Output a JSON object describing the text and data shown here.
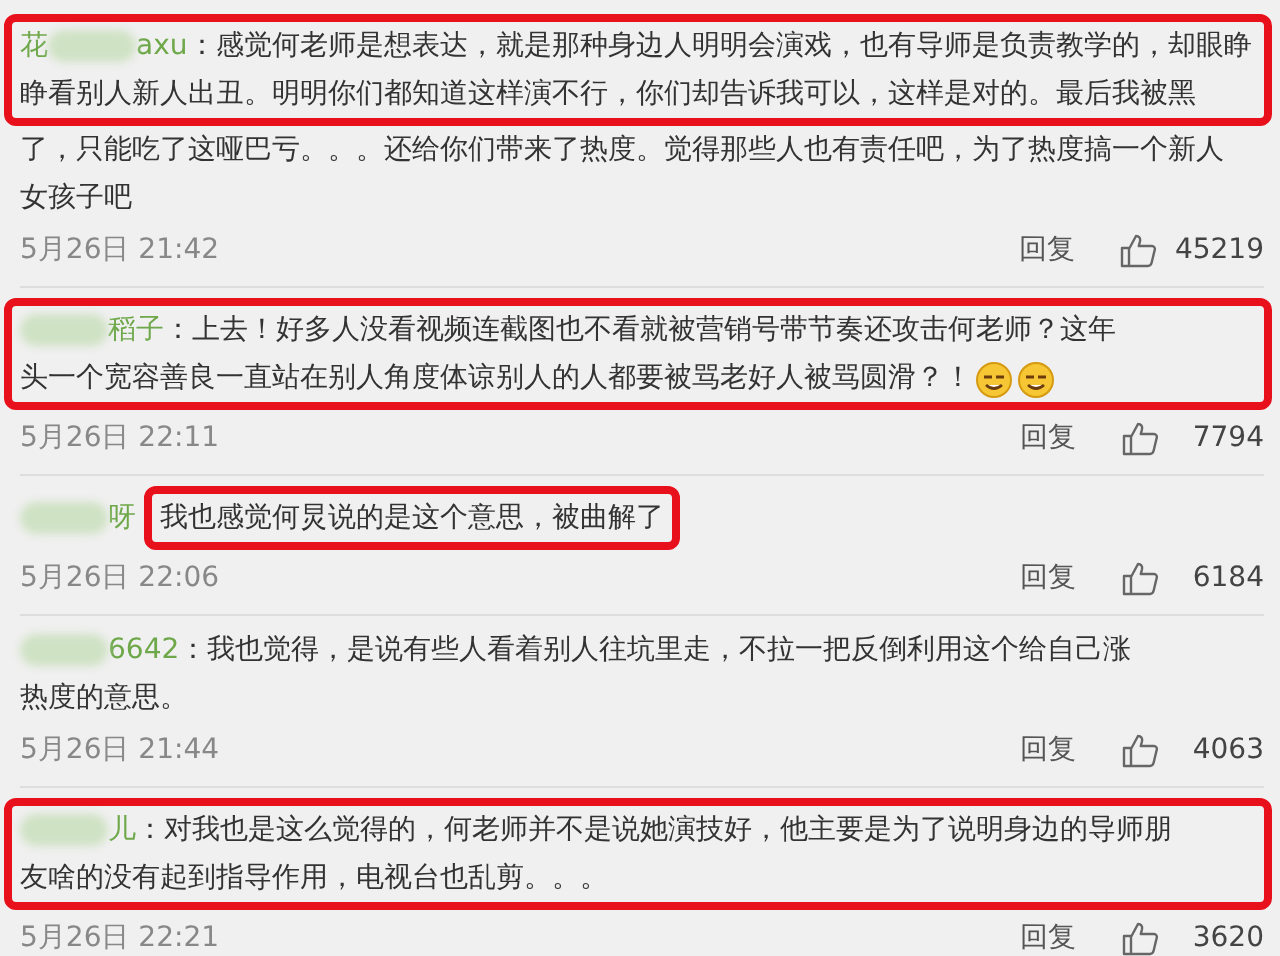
{
  "comments": [
    {
      "username": "axu",
      "username_prefix": "花",
      "username_highlighted": true,
      "lines": [
        {
          "text": "：感觉何老师是想表达，就是那种身边人明明会演戏，也有导师是负责教学的，却眼睁",
          "highlighted": true
        },
        {
          "text": "睁看别人新人出丑。明明你们都知道这样演不行，你们却告诉我可以，这样是对的。最后我被黑",
          "highlighted": true
        },
        {
          "text": "了，只能吃了这哑巴亏。。。还给你们带来了热度。觉得那些人也有责任吧，为了热度搞一个新人",
          "highlighted": false
        },
        {
          "text": "女孩子吧",
          "highlighted": false
        }
      ],
      "time": "5月26日 21:42",
      "reply": "回复",
      "likes": "45219"
    },
    {
      "username": "稻子",
      "username_highlighted": true,
      "lines": [
        {
          "text": "：上去！好多人没看视频连截图也不看就被营销号带节奏还攻击何老师？这年",
          "highlighted": true
        },
        {
          "text": "头一个宽容善良一直站在别人角度体谅别人的人都要被骂老好人被骂圆滑？！",
          "highlighted": true
        }
      ],
      "emojis": [
        {
          "kind": "smiley"
        },
        {
          "kind": "smiley"
        }
      ],
      "time": "5月26日 22:11",
      "reply": "回复",
      "likes": "7794"
    },
    {
      "username": "呀",
      "username_highlighted": false,
      "lines": [
        {
          "text": "我也感觉何炅说的是这个意思，被曲解了",
          "highlighted": true
        }
      ],
      "time": "5月26日 22:06",
      "reply": "回复",
      "likes": "6184"
    },
    {
      "username": "6642",
      "username_highlighted": false,
      "lines": [
        {
          "text": "：我也觉得，是说有些人看着别人往坑里走，不拉一把反倒利用这个给自己涨",
          "highlighted": false
        },
        {
          "text": "热度的意思。",
          "highlighted": false
        }
      ],
      "time": "5月26日 21:44",
      "reply": "回复",
      "likes": "4063"
    },
    {
      "username": "儿",
      "username_highlighted": true,
      "lines": [
        {
          "text": "：对我也是这么觉得的，何老师并不是说她演技好，他主要是为了说明身边的导师朋",
          "highlighted": true
        },
        {
          "text": "友啥的没有起到指导作用，电视台也乱剪。。。",
          "highlighted": true
        }
      ],
      "time": "5月26日 22:21",
      "reply": "回复",
      "likes": "3620"
    }
  ]
}
